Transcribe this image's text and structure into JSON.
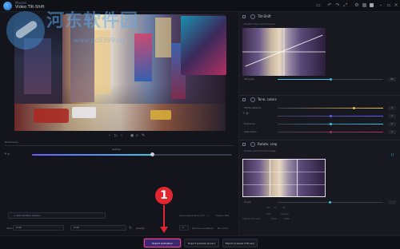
{
  "window": {
    "subtitle": "Movavi",
    "title": "Video Tilt-Shift"
  },
  "watermark": {
    "text": "河东软件园",
    "url": "www.pc0359.cn"
  },
  "preview": {
    "controls": {
      "prev": "‹",
      "play": "▷",
      "next": "›"
    },
    "bookmark_label": "Bookmarks",
    "section_label": "Section",
    "time_start": "0:00",
    "progress": 0.6
  },
  "left_bottom": {
    "add_marker_label": "+ Add another section",
    "from_label": "Start",
    "from_value": "0:00",
    "to_value": "0:00",
    "quality_label": "Quality",
    "quality_value": "1",
    "check_1": "Remove audio",
    "check_2": "Loop",
    "check_3": "No audio",
    "checkbox_hint_a": "Use original size (not ...)",
    "checkbox_hint_b": "Same ratio"
  },
  "bottom_bar": {
    "export_button": "Export animation",
    "export_b": "Export preview (0 sec)",
    "export_c": "Export preview (HQ sec)"
  },
  "annotation": {
    "number": "1"
  },
  "right_panel": {
    "tiltshift": {
      "title": "Tilt-Shift",
      "sub": "Position the control frame",
      "slider_label": "Strength",
      "value": "50"
    },
    "tone": {
      "title": "Tone, colors",
      "rows": [
        {
          "label": "White balance",
          "value": "0",
          "fill": 0.72,
          "color": "#e9c24a"
        },
        {
          "label": "",
          "value": "0",
          "fill": 0.5,
          "color": "#6a5cff"
        },
        {
          "label": "Exposure",
          "value": "0",
          "fill": 0.5,
          "color": "#3ac6e8"
        },
        {
          "label": "Saturation",
          "value": "0",
          "fill": 0.5,
          "color": "#b03060"
        }
      ]
    },
    "rotate_crop": {
      "title": "Rotate, crop",
      "sub": "Rotate and trim the image"
    },
    "crop_info": {
      "angle_label": "Angle",
      "angle_vals": [
        "-90°",
        "0°",
        "90°"
      ],
      "fit_a": "Free",
      "fit_b": "Original",
      "size_label": "Output video size",
      "size_vals": [
        "1920",
        "1080"
      ]
    }
  }
}
